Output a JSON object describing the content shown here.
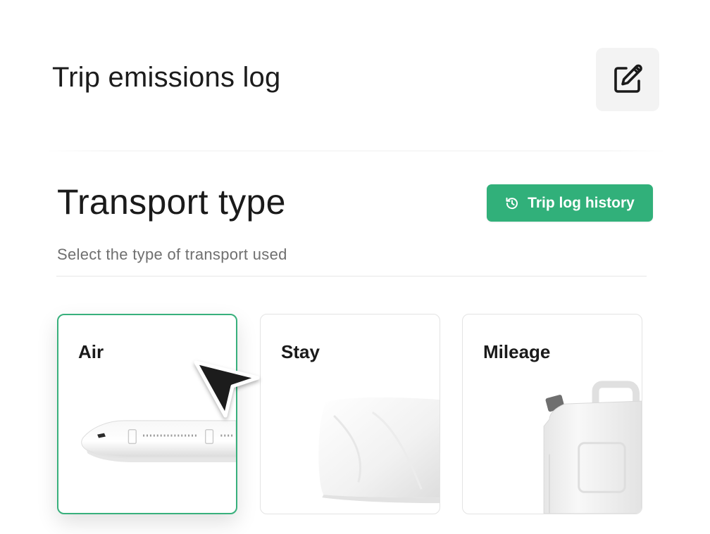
{
  "header": {
    "title": "Trip emissions log",
    "edit_icon": "edit-icon"
  },
  "section": {
    "title": "Transport type",
    "subtitle": "Select the type of transport used",
    "history_button": {
      "label": "Trip log history",
      "icon": "history-icon"
    }
  },
  "transport_options": [
    {
      "label": "Air",
      "icon": "airplane-image",
      "selected": true
    },
    {
      "label": "Stay",
      "icon": "pillow-image",
      "selected": false
    },
    {
      "label": "Mileage",
      "icon": "fuel-canister-image",
      "selected": false
    }
  ],
  "colors": {
    "accent": "#31b07a",
    "selected_border": "#38b07c",
    "text_primary": "#1a1a1a",
    "text_secondary": "#6f6f6f"
  }
}
